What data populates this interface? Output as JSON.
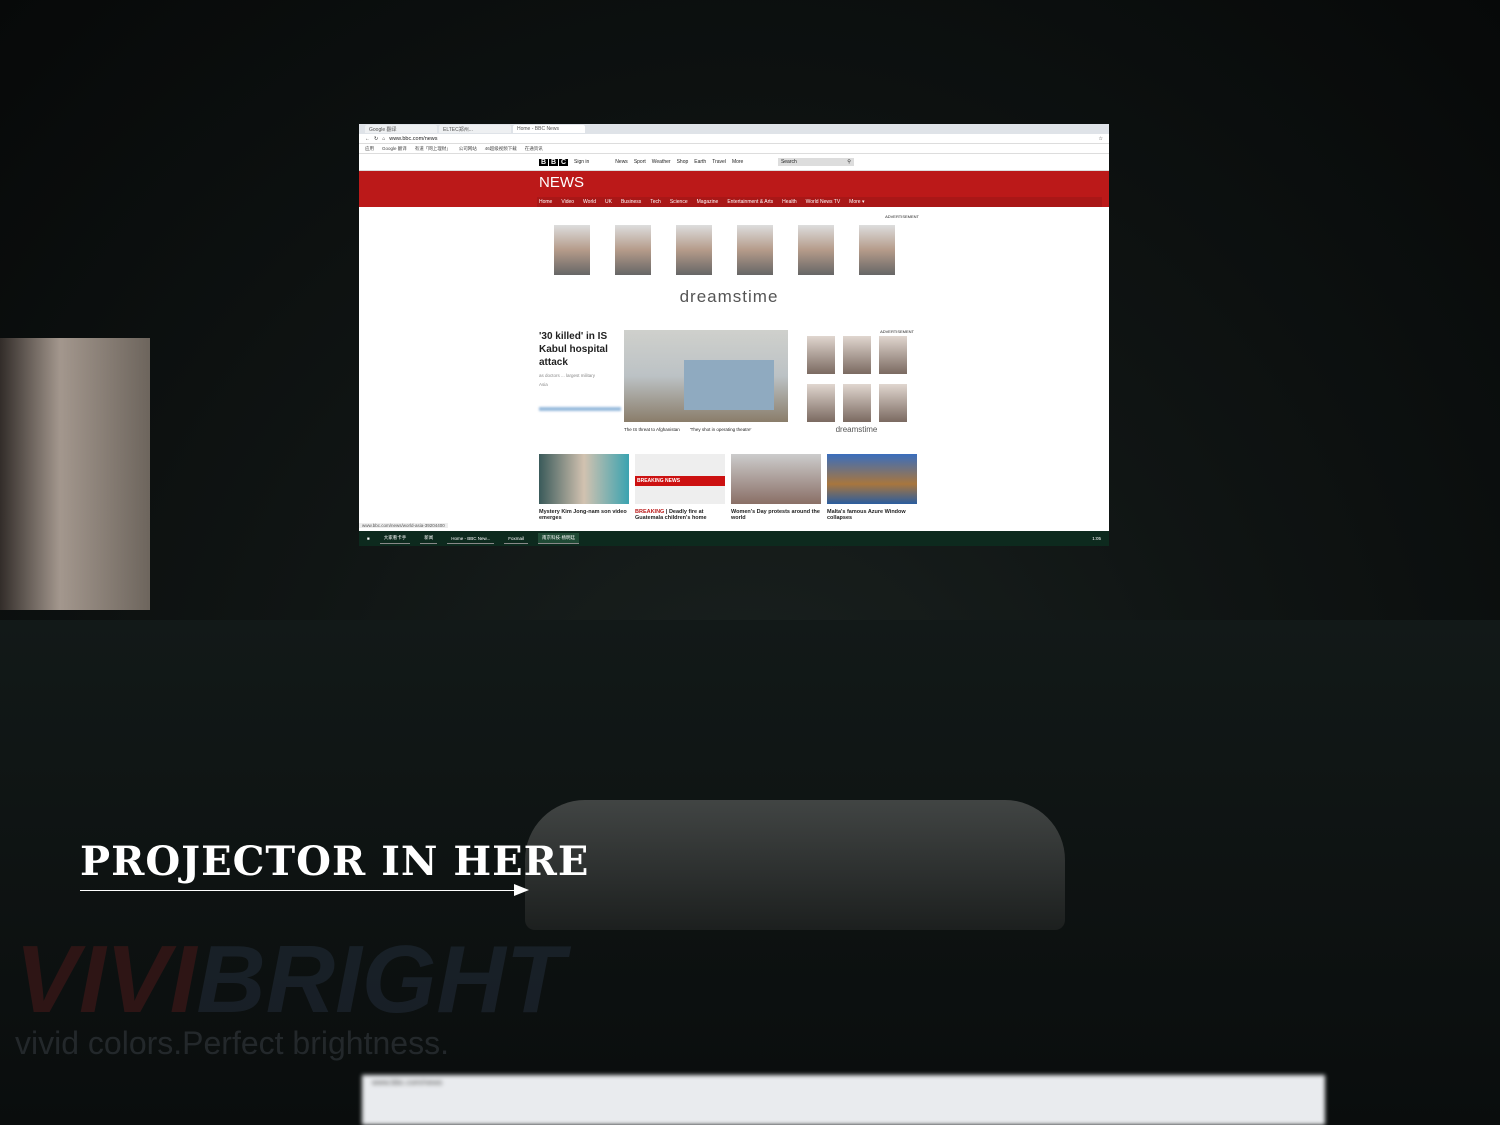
{
  "browser": {
    "tabs": [
      "Google 翻译",
      "ELTEC郑州...",
      "Home - BBC News"
    ],
    "url": "www.bbc.com/news",
    "bookmarks": [
      "应用",
      "Google 翻译",
      "有道「网上理财」",
      "公司网站",
      "46超级视频下载",
      "在通资讯"
    ]
  },
  "bbc": {
    "logo": [
      "B",
      "B",
      "C"
    ],
    "sign_in": "Sign in",
    "top_nav": [
      "News",
      "Sport",
      "Weather",
      "Shop",
      "Earth",
      "Travel",
      "More"
    ],
    "search_placeholder": "Search",
    "section_title": "NEWS",
    "sub_nav": [
      "Home",
      "Video",
      "World",
      "UK",
      "Business",
      "Tech",
      "Science",
      "Magazine",
      "Entertainment & Arts",
      "Health",
      "World News TV",
      "More ▾"
    ]
  },
  "ads": {
    "label": "ADVERTISEMENT",
    "brand": "dreamstime"
  },
  "lead": {
    "headline": "'30 killed' in IS Kabul hospital attack",
    "summary": "as doctors ... largest military",
    "region": "Asia",
    "related": [
      "The IS threat to Afghanistan",
      "'They shot in operating theatre'"
    ]
  },
  "cards": [
    {
      "title": "Mystery Kim Jong-nam son video emerges"
    },
    {
      "badge": "BREAKING",
      "title": "Deadly fire at Guatemala children's home",
      "image_text": "BREAKING NEWS"
    },
    {
      "title": "Women's Day protests around the world"
    },
    {
      "title": "Malta's famous Azure Window collapses"
    }
  ],
  "status_url": "www.bbc.com/news/world-asia-39204400",
  "taskbar": {
    "items": [
      "大家看卡手",
      "新闻",
      "Home - BBC New...",
      "Foxmail",
      "南京科技·杨明廷"
    ],
    "clock": "1:05"
  },
  "overlay": {
    "caption": "PROJECTOR IN HERE",
    "watermark_a": "VIVI",
    "watermark_b": "BRIGHT",
    "tagline": "vivid colors.Perfect brightness."
  }
}
